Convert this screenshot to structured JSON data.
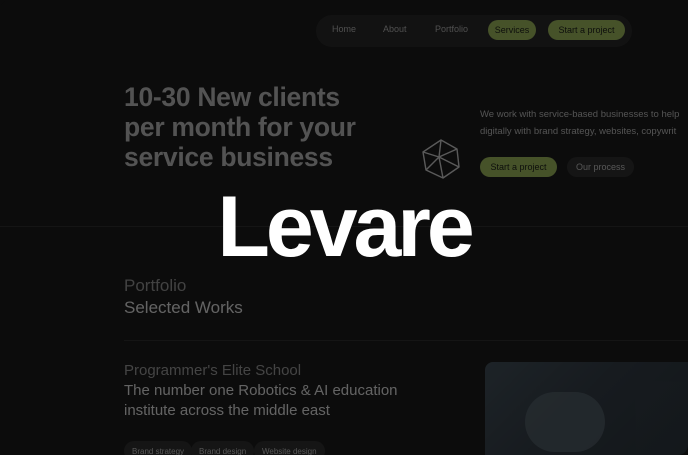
{
  "nav": {
    "links": [
      "Home",
      "About",
      "Portfolio"
    ],
    "active_label": "Services",
    "cta_label": "Start a project"
  },
  "hero": {
    "title_lines": [
      "10-30 New clients",
      "per month for your",
      "service business"
    ],
    "description_lines": [
      "We work with service-based businesses to help",
      "digitally with brand strategy, websites, copywrit"
    ],
    "primary_button": "Start a project",
    "secondary_button": "Our process"
  },
  "logo": {
    "text": "Levare"
  },
  "portfolio": {
    "label": "Portfolio",
    "title": "Selected Works",
    "project": {
      "name": "Programmer's Elite School",
      "description_lines": [
        "The number one Robotics & AI education",
        "institute across the middle east"
      ],
      "tags": [
        "Brand strategy",
        "Brand design",
        "Website design"
      ]
    }
  },
  "colors": {
    "background": "#0c0c0c",
    "accent": "#a4c35a",
    "logo": "#ffffff"
  }
}
